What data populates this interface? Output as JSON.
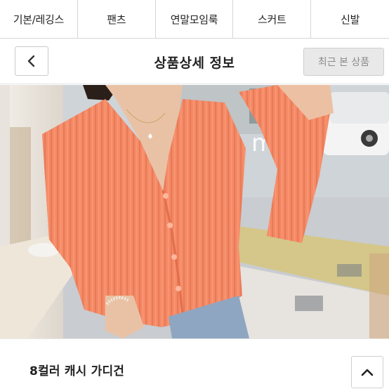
{
  "categories": [
    {
      "label": "기본/레깅스"
    },
    {
      "label": "팬츠"
    },
    {
      "label": "연말모임룩"
    },
    {
      "label": "스커트"
    },
    {
      "label": "신발"
    }
  ],
  "header": {
    "title": "상품상세 정보",
    "recent_label": "최근 본 상품",
    "back_icon": "chevron-left-icon"
  },
  "photo": {
    "storefront_text": "mea",
    "subject": "coral ribbed v-neck cardigan"
  },
  "product": {
    "name": "8컬러 캐시 가디건",
    "scroll_up_icon": "chevron-up-icon"
  },
  "colors": {
    "cardigan": "#f58a66",
    "recent_button_bg": "#e9e9e9",
    "border": "#d6d6d6"
  }
}
